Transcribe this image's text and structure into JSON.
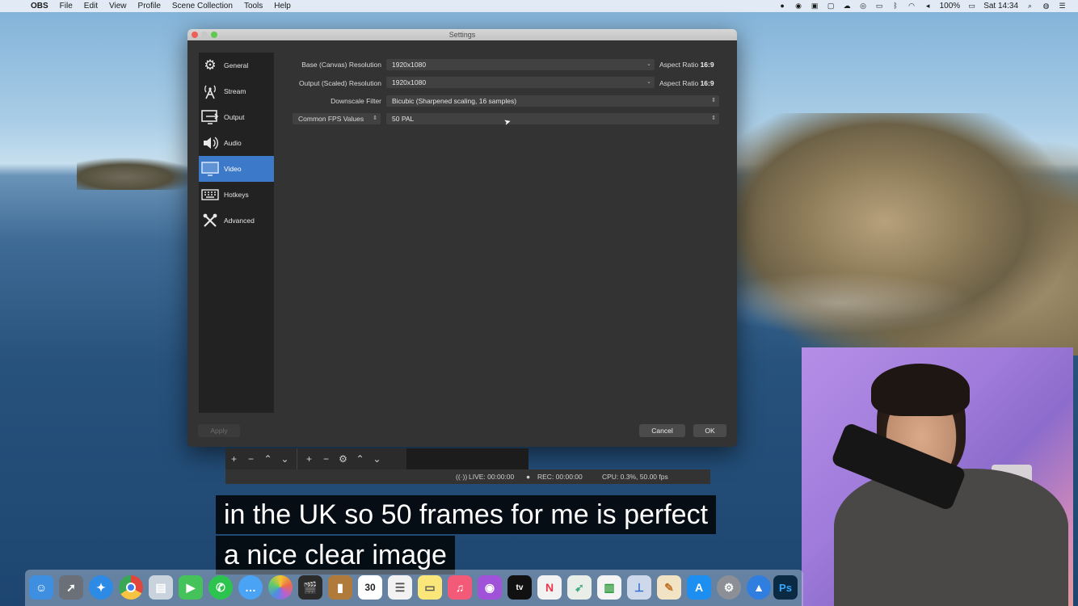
{
  "menubar": {
    "app_name": "OBS",
    "items": [
      "File",
      "Edit",
      "View",
      "Profile",
      "Scene Collection",
      "Tools",
      "Help"
    ],
    "battery": "100%",
    "clock": "Sat 14:34"
  },
  "window": {
    "title": "Settings",
    "sidebar": [
      {
        "label": "General",
        "icon": "gear-icon"
      },
      {
        "label": "Stream",
        "icon": "antenna-icon"
      },
      {
        "label": "Output",
        "icon": "output-icon"
      },
      {
        "label": "Audio",
        "icon": "speaker-icon"
      },
      {
        "label": "Video",
        "icon": "monitor-icon"
      },
      {
        "label": "Hotkeys",
        "icon": "keyboard-icon"
      },
      {
        "label": "Advanced",
        "icon": "tools-icon"
      }
    ],
    "active_item": "Video",
    "video": {
      "base_label": "Base (Canvas) Resolution",
      "base_value": "1920x1080",
      "base_aspect_prefix": "Aspect Ratio",
      "base_aspect_value": "16:9",
      "output_label": "Output (Scaled) Resolution",
      "output_value": "1920x1080",
      "output_aspect_prefix": "Aspect Ratio",
      "output_aspect_value": "16:9",
      "downscale_label": "Downscale Filter",
      "downscale_value": "Bicubic (Sharpened scaling, 16 samples)",
      "fps_type": "Common FPS Values",
      "fps_value": "50 PAL"
    },
    "buttons": {
      "apply": "Apply",
      "cancel": "Cancel",
      "ok": "OK"
    },
    "accent_color": "#3c79c9"
  },
  "obs_status": {
    "live": "LIVE: 00:00:00",
    "rec": "REC: 00:00:00",
    "cpu": "CPU: 0.3%, 50.00 fps"
  },
  "subtitles": {
    "line1": "in the UK so 50 frames for me is perfect",
    "line2": "a nice clear image"
  },
  "dock": {
    "calendar_day": "30",
    "apple_tv_label": "tv",
    "photoshop_label": "Ps"
  }
}
